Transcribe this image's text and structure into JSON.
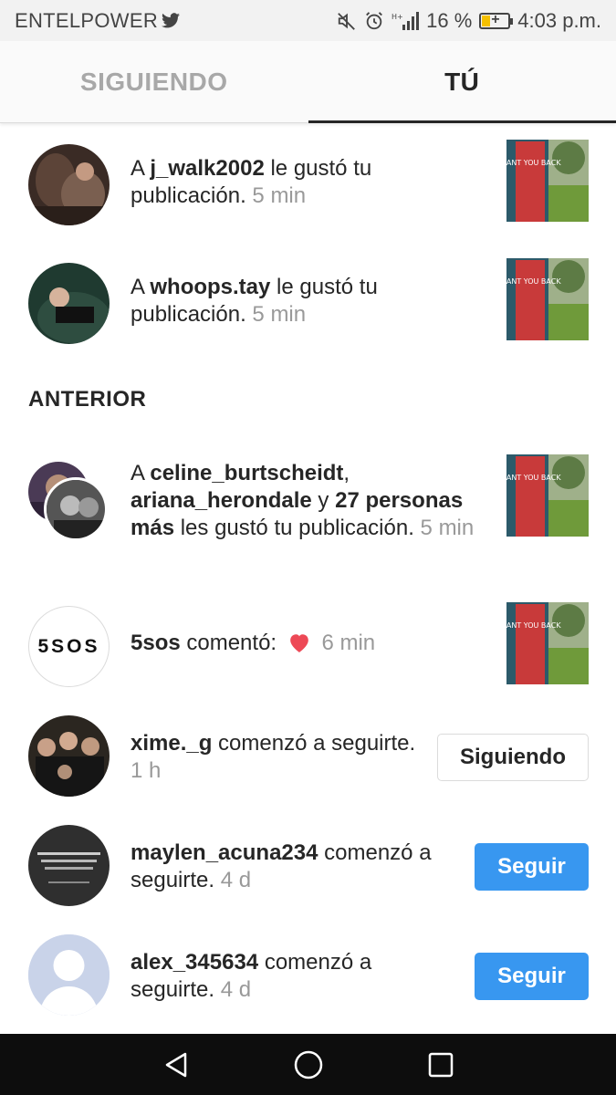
{
  "status_bar": {
    "carrier": "ENTELPOWER",
    "battery_percent": "16 %",
    "clock": "4:03 p.m."
  },
  "tabs": [
    {
      "label": "SIGUIENDO",
      "active": false
    },
    {
      "label": "TÚ",
      "active": true
    }
  ],
  "notifications": [
    {
      "prefix": "A ",
      "user": "j_walk2002",
      "text": " le gustó tu publicación.",
      "time": "5 min"
    },
    {
      "prefix": "A ",
      "user": "whoops.tay",
      "text": " le gustó tu publicación.",
      "time": "5 min"
    }
  ],
  "section_label": "ANTERIOR",
  "earlier": {
    "group_like": {
      "prefix": "A ",
      "user1": "celine_burtscheidt",
      "sep": ",",
      "user2": "ariana_herondale",
      "conj": " y ",
      "others": "27 personas más",
      "text": " les gustó tu publicación.",
      "time": "5 min"
    },
    "comment": {
      "avatar_text": "5SOS",
      "user": "5sos",
      "text": " comentó: ",
      "time": "6 min"
    },
    "follows": [
      {
        "user": "xime._g",
        "text": " comenzó a seguirte.",
        "time": "1 h",
        "button": "Siguiendo"
      },
      {
        "user": "maylen_acuna234",
        "text": " comenzó a seguirte.",
        "time": "4 d",
        "button": "Seguir"
      },
      {
        "user": "alex_345634",
        "text": " comenzó a seguirte.",
        "time": "4 d",
        "button": "Seguir"
      }
    ]
  },
  "thumbnail_text": "WANT YOU BACK",
  "colors": {
    "follow_button": "#3897f0",
    "heart": "#ed4956",
    "text": "#262626",
    "muted": "#999999"
  }
}
